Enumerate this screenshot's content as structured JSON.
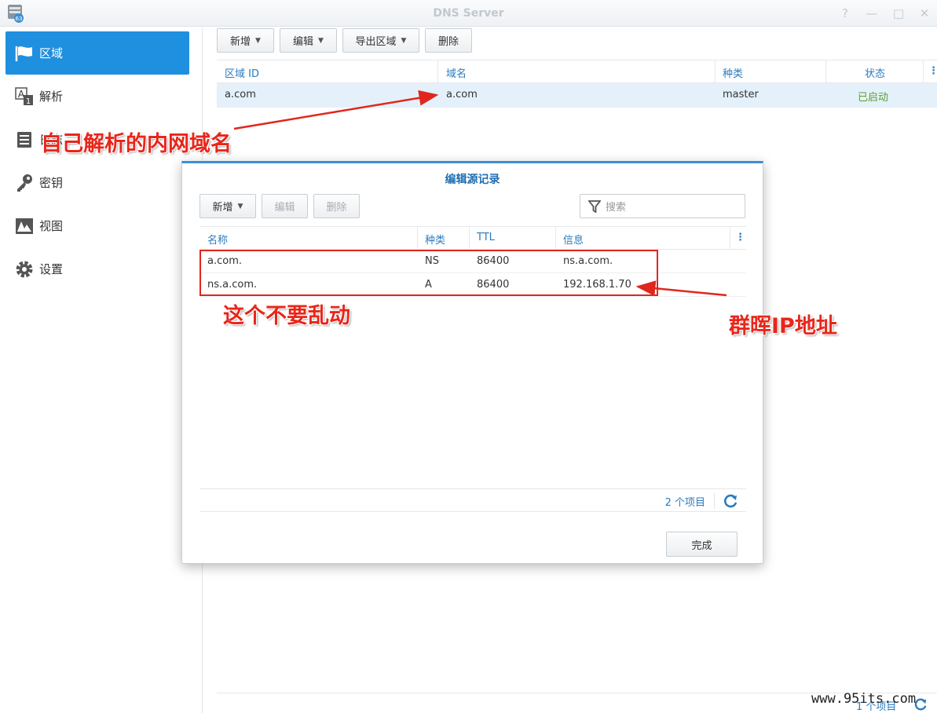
{
  "window": {
    "title": "DNS Server"
  },
  "sidebar": {
    "items": [
      {
        "label": "区域",
        "icon": "flag-icon",
        "active": true
      },
      {
        "label": "解析",
        "icon": "resolve-icon",
        "active": false
      },
      {
        "label": "日志",
        "icon": "list-icon",
        "active": false
      },
      {
        "label": "密钥",
        "icon": "key-icon",
        "active": false
      },
      {
        "label": "视图",
        "icon": "map-icon",
        "active": false
      },
      {
        "label": "设置",
        "icon": "gear-icon",
        "active": false
      }
    ]
  },
  "toolbar": {
    "create": "新增",
    "edit": "编辑",
    "export": "导出区域",
    "delete": "删除"
  },
  "zones_table": {
    "headers": [
      "区域 ID",
      "域名",
      "种类",
      "状态"
    ],
    "rows": [
      {
        "zone_id": "a.com",
        "domain": "a.com",
        "type": "master",
        "status": "已启动"
      }
    ]
  },
  "footer": {
    "count": "1 个项目"
  },
  "dialog": {
    "title": "编辑源记录",
    "toolbar": {
      "create": "新增",
      "edit": "编辑",
      "delete": "删除"
    },
    "search_placeholder": "搜索",
    "headers": [
      "名称",
      "种类",
      "TTL",
      "信息"
    ],
    "rows": [
      {
        "name": "a.com.",
        "type": "NS",
        "ttl": "86400",
        "info": "ns.a.com."
      },
      {
        "name": "ns.a.com.",
        "type": "A",
        "ttl": "86400",
        "info": "192.168.1.70"
      }
    ],
    "count": "2 个项目",
    "done": "完成"
  },
  "annotations": {
    "domain_note": "自己解析的内网域名",
    "dont_touch": "这个不要乱动",
    "nas_ip": "群晖IP地址"
  },
  "watermark": "www.95its.com",
  "colors": {
    "accent": "#1f8fdf",
    "header_text": "#2a7bbf",
    "status_ok": "#5a9e2e",
    "annotation": "#e8261a"
  }
}
